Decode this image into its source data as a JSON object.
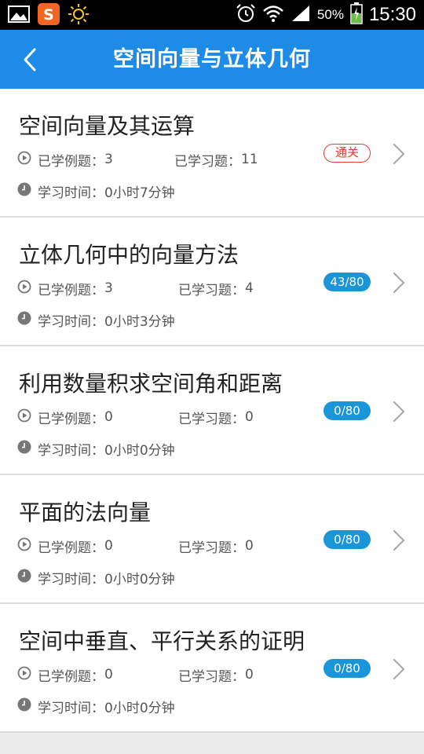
{
  "status_bar": {
    "battery": "50%",
    "time": "15:30",
    "left_icons": [
      "gallery-icon",
      "sogou-icon",
      "brightness-icon"
    ],
    "right_icons": [
      "alarm-icon",
      "wifi-icon",
      "signal-icon",
      "battery-icon"
    ]
  },
  "app_bar": {
    "title": "空间向量与立体几何",
    "back_icon": "chevron-left-icon"
  },
  "labels": {
    "examples": "已学例题：",
    "practice": "已学习题：",
    "time": "学习时间："
  },
  "items": [
    {
      "title": "空间向量及其运算",
      "examples": "3",
      "practice": "11",
      "time": "0小时7分钟",
      "badge": "通关",
      "badge_style": "red"
    },
    {
      "title": "立体几何中的向量方法",
      "examples": "3",
      "practice": "4",
      "time": "0小时3分钟",
      "badge": "43/80",
      "badge_style": "blue"
    },
    {
      "title": "利用数量积求空间角和距离",
      "examples": "0",
      "practice": "0",
      "time": "0小时0分钟",
      "badge": "0/80",
      "badge_style": "blue"
    },
    {
      "title": "平面的法向量",
      "examples": "0",
      "practice": "0",
      "time": "0小时0分钟",
      "badge": "0/80",
      "badge_style": "blue"
    },
    {
      "title": "空间中垂直、平行关系的证明",
      "examples": "0",
      "practice": "0",
      "time": "0小时0分钟",
      "badge": "0/80",
      "badge_style": "blue"
    }
  ],
  "colors": {
    "app_bar": "#1e8ce6",
    "badge_blue": "#1a96d8",
    "badge_red": "#e53935"
  }
}
